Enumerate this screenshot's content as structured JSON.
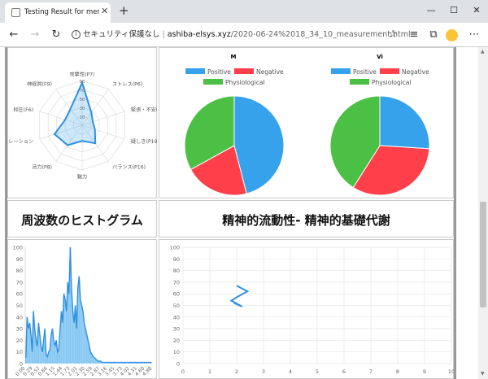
{
  "browser": {
    "tab_title": "Testing Result for mental-functio",
    "security_label": "セキュリティ保護なし",
    "url_host": "ashiba-elsys.xyz",
    "url_path": "/2020-06-24%2018_34_10_measurement.html"
  },
  "radar": {
    "labels": [
      "攻撃性(P7)",
      "ストレス(P6)",
      "緊張・不安(F5X)",
      "疑しき(P19)",
      "バランス(P16)",
      "魅力",
      "活力(P8)",
      "セルフレギュレーション",
      "抑圧(F6)",
      "神経質(F9)"
    ],
    "ticks": [
      "90",
      "70",
      "50",
      "30",
      "10"
    ]
  },
  "pie_m": {
    "title": "M",
    "legend": [
      "Positive",
      "Negative",
      "Physiological"
    ],
    "values": [
      46,
      21,
      33
    ]
  },
  "pie_vi": {
    "title": "Vi",
    "legend": [
      "Positive",
      "Negative",
      "Physiological"
    ],
    "values": [
      26,
      33,
      41
    ]
  },
  "headings": {
    "histogram": "周波数のヒストグラム",
    "metabolism": "精神的流動性- 精神的基礎代謝"
  },
  "chart_data": [
    {
      "type": "bar",
      "title": "",
      "y_ticks": [
        "0",
        "10",
        "20",
        "30",
        "40",
        "50",
        "60",
        "70",
        "80",
        "90",
        "100"
      ],
      "x_ticks": [
        "0.00",
        "0.29",
        "0.57",
        "0.86",
        "1.15",
        "1.44",
        "1.73",
        "2.01",
        "2.30",
        "2.59",
        "2.87",
        "3.16",
        "3.45",
        "3.73",
        "4.02",
        "4.31",
        "4.60",
        "4.88"
      ],
      "values": [
        5,
        40,
        30,
        35,
        25,
        10,
        45,
        30,
        20,
        15,
        35,
        25,
        15,
        10,
        20,
        30,
        8,
        6,
        10,
        12,
        25,
        30,
        20,
        15,
        20,
        10,
        12,
        30,
        45,
        35,
        60,
        55,
        45,
        70,
        60,
        100,
        65,
        45,
        35,
        50,
        30,
        65,
        75,
        55,
        50,
        45,
        35,
        30,
        25,
        20,
        15,
        10,
        8,
        6,
        5,
        4,
        3,
        2,
        2,
        2,
        1,
        1,
        1,
        1,
        1,
        1,
        1,
        1,
        1,
        1,
        1,
        1,
        1,
        1,
        1,
        1,
        1,
        1,
        1,
        1,
        1,
        1,
        1,
        1,
        1,
        1,
        1,
        1,
        1,
        1,
        1,
        1,
        1,
        1,
        1,
        1,
        1,
        1,
        1,
        1
      ],
      "ylim": [
        0,
        100
      ]
    },
    {
      "type": "line",
      "title": "",
      "y_ticks": [
        "0",
        "10",
        "20",
        "30",
        "40",
        "50",
        "60",
        "70",
        "80",
        "90",
        "100"
      ],
      "x_ticks": [
        "0",
        "1",
        "2",
        "3",
        "4",
        "5",
        "6",
        "7",
        "8",
        "9",
        "10"
      ],
      "x": [
        2.0,
        2.4,
        2.0,
        1.8,
        2.2,
        1.9
      ],
      "y": [
        67,
        62,
        57,
        54,
        49,
        52
      ],
      "xlim": [
        0,
        10
      ],
      "ylim": [
        0,
        100
      ]
    }
  ]
}
